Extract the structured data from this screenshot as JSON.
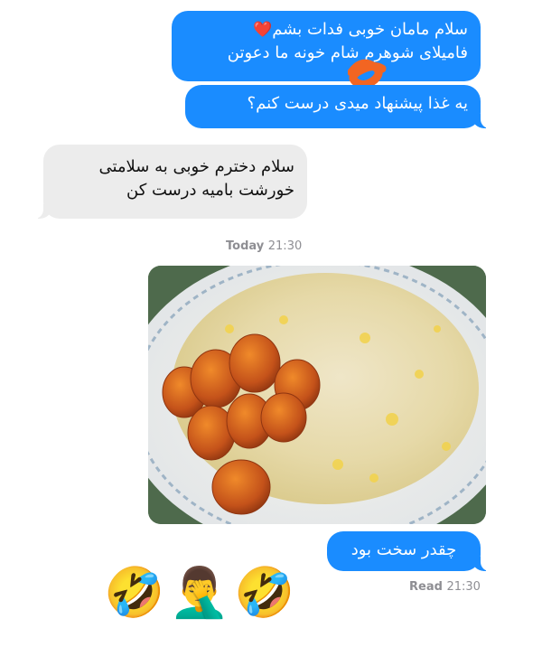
{
  "messages": [
    {
      "id": "m1",
      "direction": "outgoing",
      "lines": [
        "سلام مامان خوبی فدات بشم",
        "فامیلای شوهرم شام خونه ما دعوتن"
      ],
      "emoji": "❤️"
    },
    {
      "id": "m2",
      "direction": "outgoing",
      "lines": [
        "یه غذا پیشنهاد میدی درست کنم؟"
      ]
    },
    {
      "id": "m3",
      "direction": "incoming",
      "lines": [
        "سلام دخترم خوبی به سلامتی",
        "خورشت بامیه درست کن"
      ]
    },
    {
      "id": "m4",
      "direction": "outgoing",
      "lines": [
        "چقدر سخت بود"
      ]
    }
  ],
  "timestamps": {
    "today": {
      "label": "Today",
      "time": "21:30"
    },
    "read": {
      "label": "Read",
      "time": "21:30"
    }
  },
  "photo": {
    "description_icon": "food-photo-rice-and-bamieh"
  },
  "reactions": [
    {
      "icon": "rolling-on-floor-laughing-emoji",
      "glyph": "🤣"
    },
    {
      "icon": "man-facepalming-emoji",
      "glyph": "🤦‍♂️"
    },
    {
      "icon": "rolling-on-floor-laughing-emoji",
      "glyph": "🤣"
    }
  ],
  "colors": {
    "outgoing": "#1a8cff",
    "incoming": "#ececec",
    "stamp": "#8e8e93",
    "scribble": "#f26522"
  }
}
